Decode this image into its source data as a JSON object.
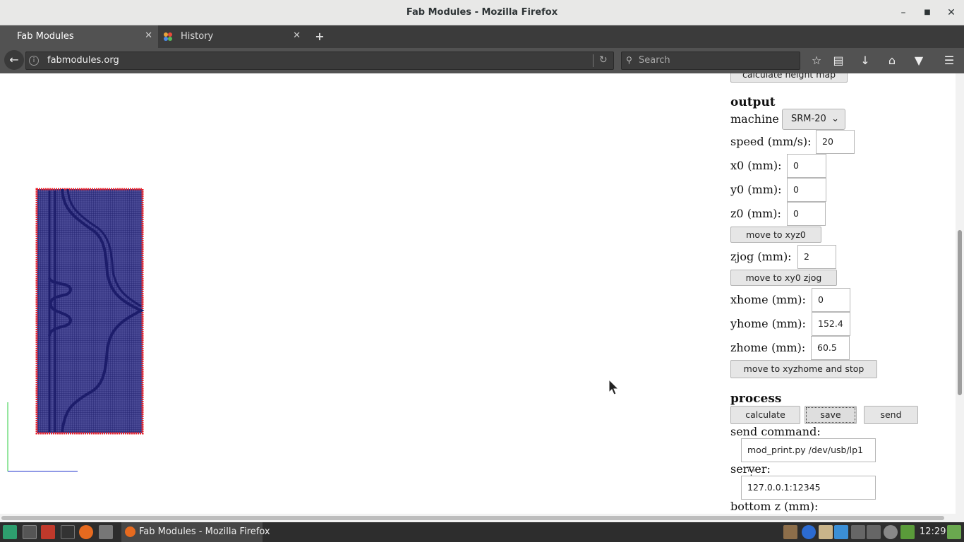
{
  "window": {
    "title": "Fab Modules - Mozilla Firefox"
  },
  "tabs": [
    {
      "label": "Fab Modules",
      "active": true
    },
    {
      "label": "History",
      "active": false
    }
  ],
  "navbar": {
    "url": "fabmodules.org",
    "search_placeholder": "Search"
  },
  "panel": {
    "partial_button": "calculate height map",
    "output": {
      "heading": "output",
      "machine_label": "machine",
      "machine_value": "SRM-20",
      "speed_label": "speed (mm/s):",
      "speed_value": "20",
      "x0_label": "x0 (mm):",
      "x0_value": "0",
      "y0_label": "y0 (mm):",
      "y0_value": "0",
      "z0_label": "z0 (mm):",
      "z0_value": "0",
      "move_xyz0": "move to xyz0",
      "zjog_label": "zjog (mm):",
      "zjog_value": "2",
      "move_xy0_zjog": "move to xy0 zjog",
      "xhome_label": "xhome (mm):",
      "xhome_value": "0",
      "yhome_label": "yhome (mm):",
      "yhome_value": "152.4",
      "zhome_label": "zhome (mm):",
      "zhome_value": "60.5",
      "move_xyzhome": "move to xyzhome and stop"
    },
    "process": {
      "heading": "process",
      "calculate": "calculate",
      "save": "save",
      "send": "send",
      "send_command_label": "send command:",
      "send_command_value": "mod_print.py /dev/usb/lp1 ';'",
      "server_label": "server:",
      "server_value": "127.0.0.1:12345",
      "bottom_z_label": "bottom z (mm):"
    }
  },
  "taskbar": {
    "active_task": "Fab Modules - Mozilla Firefox",
    "clock": "12:29"
  },
  "colors": {
    "toolpath": "#1d1d6b",
    "outline": "#e8202a",
    "axis_y": "#2ecc40",
    "axis_x": "#2233cc"
  }
}
